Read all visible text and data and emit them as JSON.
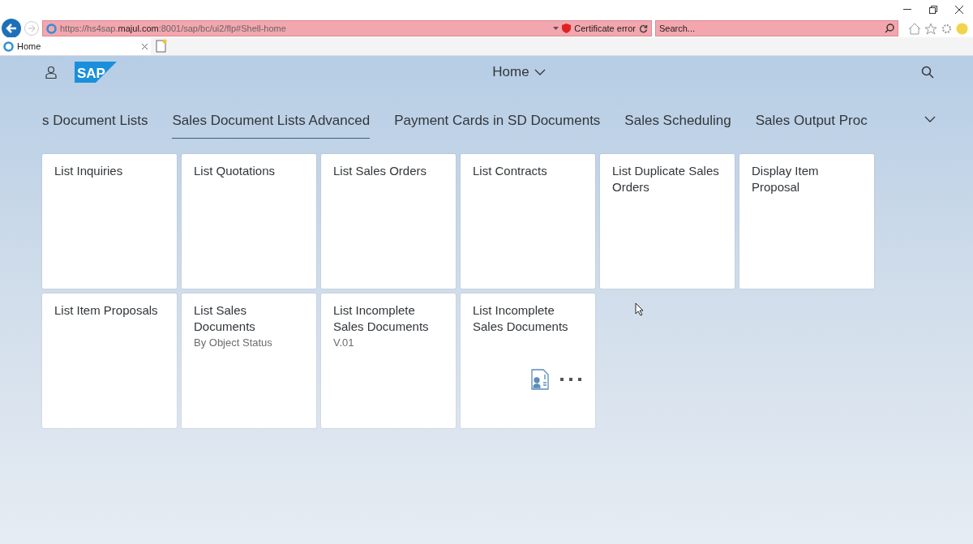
{
  "browser": {
    "address": "https://hs4sap.**majul.com**:8001/sap/bc/ui2/flp#Shell-home",
    "certificate": "Certificate error",
    "search_placeholder": "Search...",
    "tabs": [
      {
        "label": "Home",
        "selected": true
      }
    ]
  },
  "shell": {
    "logo": "SAP",
    "title": "Home"
  },
  "tabs": [
    {
      "label": "s Document Lists",
      "selected": false
    },
    {
      "label": "Sales Document Lists Advanced",
      "selected": true
    },
    {
      "label": "Payment Cards in SD Documents",
      "selected": false
    },
    {
      "label": "Sales Scheduling",
      "selected": false
    },
    {
      "label": "Sales Output Proc",
      "selected": false
    }
  ],
  "tiles": [
    {
      "title": "List Inquiries",
      "kind": "plain"
    },
    {
      "title": "List Quotations",
      "kind": "plain"
    },
    {
      "title": "List Sales Orders",
      "kind": "plain"
    },
    {
      "title": "List Contracts",
      "kind": "plain"
    },
    {
      "title": "List Duplicate Sales Orders",
      "kind": "plain"
    },
    {
      "title": "Display Item Proposal",
      "kind": "plain"
    },
    {
      "title": "List Item Proposals",
      "kind": "plain"
    },
    {
      "title": "List Sales Documents",
      "subtitle": "By Object Status",
      "kind": "plain"
    },
    {
      "title": "List Incomplete Sales Documents",
      "subtitle": "V.01",
      "kind": "plain"
    },
    {
      "title": "List Incomplete Sales Documents",
      "kind": "actions"
    }
  ]
}
